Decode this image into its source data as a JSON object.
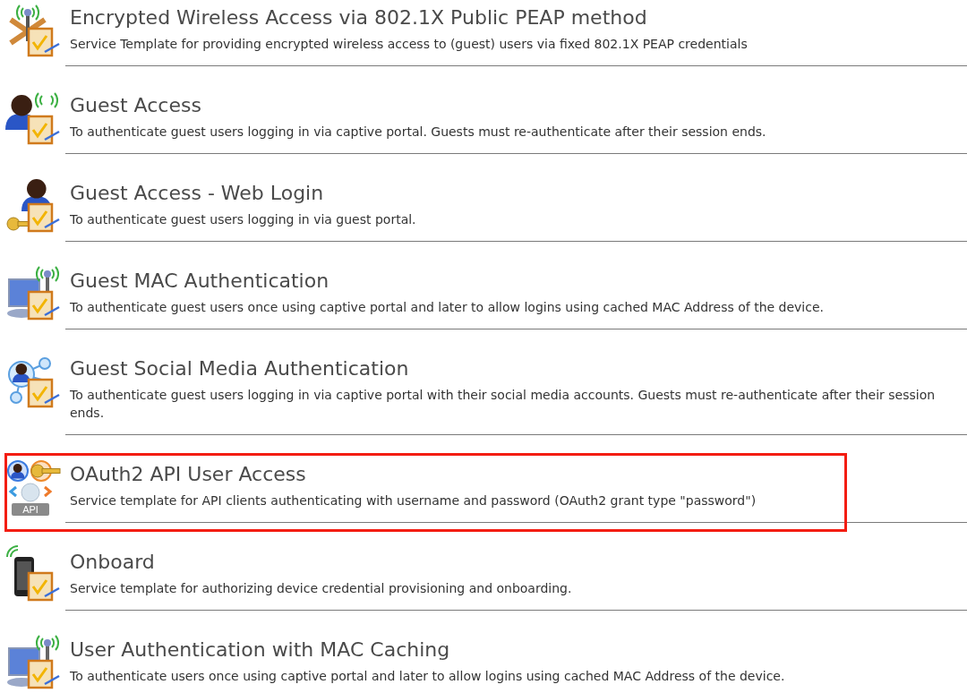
{
  "templates": [
    {
      "icon": {
        "kind": "wireless"
      },
      "title": "Encrypted Wireless Access via 802.1X Public PEAP method",
      "description": "Service Template for providing encrypted wireless access to (guest) users via fixed 802.1X PEAP credentials",
      "highlighted": false
    },
    {
      "icon": {
        "kind": "guest"
      },
      "title": "Guest Access",
      "description": "To authenticate guest users logging in via captive portal. Guests must re-authenticate after their session ends.",
      "highlighted": false
    },
    {
      "icon": {
        "kind": "guest-key"
      },
      "title": "Guest Access - Web Login",
      "description": "To authenticate guest users logging in via guest portal.",
      "highlighted": false
    },
    {
      "icon": {
        "kind": "monitor"
      },
      "title": "Guest MAC Authentication",
      "description": "To authenticate guest users once using captive portal and later to allow logins using cached MAC Address of the device.",
      "highlighted": false
    },
    {
      "icon": {
        "kind": "social"
      },
      "title": "Guest Social Media Authentication",
      "description": "To authenticate guest users logging in via captive portal with their social media accounts. Guests must re-authenticate after their session ends.",
      "highlighted": false
    },
    {
      "icon": {
        "kind": "api",
        "label": "API"
      },
      "title": "OAuth2 API User Access",
      "description": "Service template for API clients authenticating with username and password (OAuth2 grant type \"password\")",
      "highlighted": true
    },
    {
      "icon": {
        "kind": "phone"
      },
      "title": "Onboard",
      "description": "Service template for authorizing device credential provisioning and onboarding.",
      "highlighted": false
    },
    {
      "icon": {
        "kind": "monitor"
      },
      "title": "User Authentication with MAC Caching",
      "description": "To authenticate users once using captive portal and later to allow logins using cached MAC Address of the device.",
      "highlighted": false
    }
  ]
}
